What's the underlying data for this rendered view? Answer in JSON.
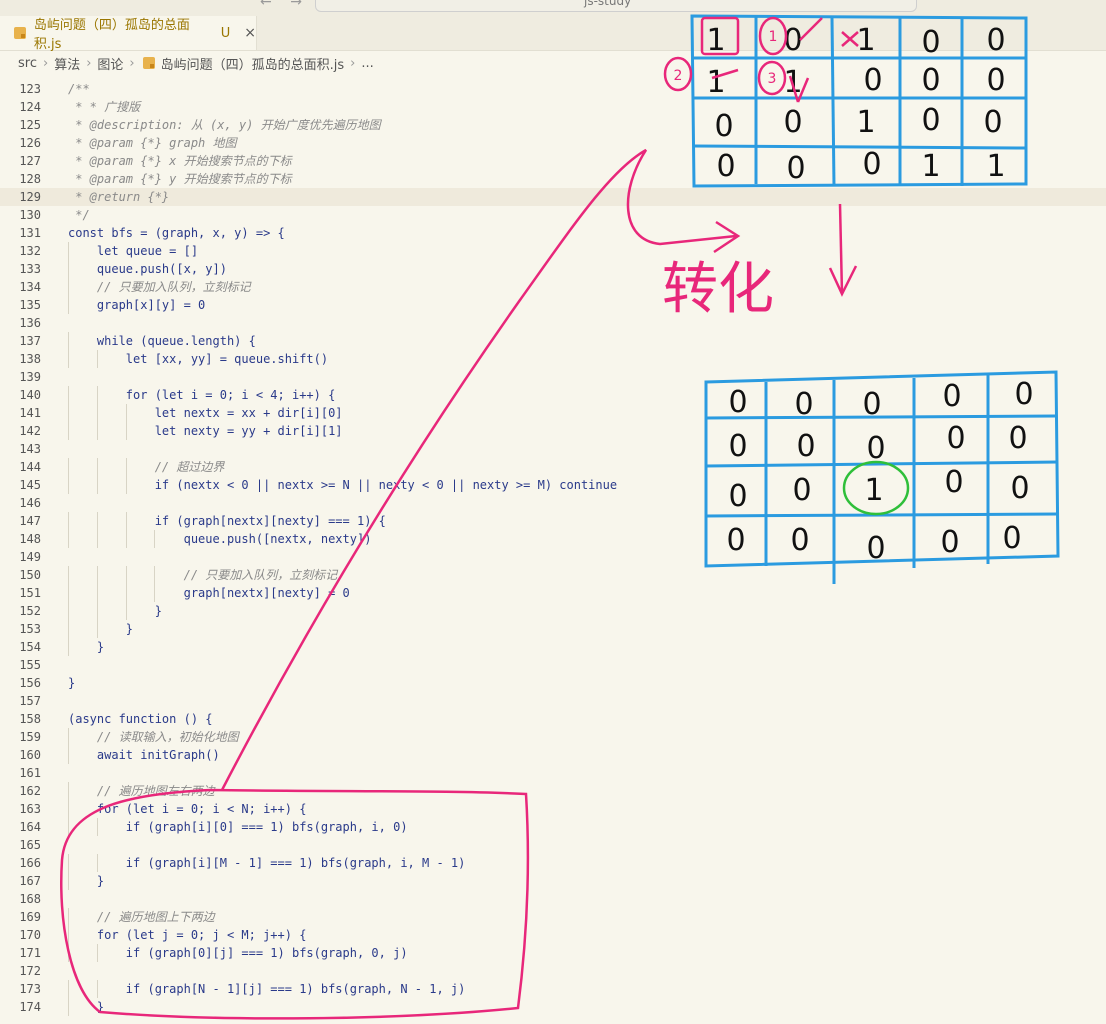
{
  "window": {
    "title": "js-study",
    "nav_back": "←",
    "nav_forward": "→"
  },
  "tab": {
    "title": "岛屿问题（四）孤岛的总面积.js",
    "status": "U",
    "close": "×"
  },
  "breadcrumb": [
    "src",
    "算法",
    "图论",
    "岛屿问题（四）孤岛的总面积.js",
    "..."
  ],
  "code_lines": [
    {
      "n": "123",
      "t": "/**"
    },
    {
      "n": "124",
      "t": " * * 广搜版"
    },
    {
      "n": "125",
      "t": " * @description: 从 (x, y) 开始广度优先遍历地图"
    },
    {
      "n": "126",
      "t": " * @param {*} graph 地图"
    },
    {
      "n": "127",
      "t": " * @param {*} x 开始搜索节点的下标"
    },
    {
      "n": "128",
      "t": " * @param {*} y 开始搜索节点的下标"
    },
    {
      "n": "129",
      "t": " * @return {*}"
    },
    {
      "n": "130",
      "t": " */"
    },
    {
      "n": "131",
      "t": "const bfs = (graph, x, y) => {"
    },
    {
      "n": "132",
      "t": "    let queue = []"
    },
    {
      "n": "133",
      "t": "    queue.push([x, y])"
    },
    {
      "n": "134",
      "t": "    // 只要加入队列，立刻标记"
    },
    {
      "n": "135",
      "t": "    graph[x][y] = 0"
    },
    {
      "n": "136",
      "t": ""
    },
    {
      "n": "137",
      "t": "    while (queue.length) {"
    },
    {
      "n": "138",
      "t": "        let [xx, yy] = queue.shift()"
    },
    {
      "n": "139",
      "t": ""
    },
    {
      "n": "140",
      "t": "        for (let i = 0; i < 4; i++) {"
    },
    {
      "n": "141",
      "t": "            let nextx = xx + dir[i][0]"
    },
    {
      "n": "142",
      "t": "            let nexty = yy + dir[i][1]"
    },
    {
      "n": "143",
      "t": ""
    },
    {
      "n": "144",
      "t": "            // 超过边界"
    },
    {
      "n": "145",
      "t": "            if (nextx < 0 || nextx >= N || nexty < 0 || nexty >= M) continue"
    },
    {
      "n": "146",
      "t": ""
    },
    {
      "n": "147",
      "t": "            if (graph[nextx][nexty] === 1) {"
    },
    {
      "n": "148",
      "t": "                queue.push([nextx, nexty])"
    },
    {
      "n": "149",
      "t": ""
    },
    {
      "n": "150",
      "t": "                // 只要加入队列，立刻标记"
    },
    {
      "n": "151",
      "t": "                graph[nextx][nexty] = 0"
    },
    {
      "n": "152",
      "t": "            }"
    },
    {
      "n": "153",
      "t": "        }"
    },
    {
      "n": "154",
      "t": "    }"
    },
    {
      "n": "155",
      "t": ""
    },
    {
      "n": "156",
      "t": "}"
    },
    {
      "n": "157",
      "t": ""
    },
    {
      "n": "158",
      "t": "(async function () {"
    },
    {
      "n": "159",
      "t": "    // 读取输入，初始化地图"
    },
    {
      "n": "160",
      "t": "    await initGraph()"
    },
    {
      "n": "161",
      "t": ""
    },
    {
      "n": "162",
      "t": "    // 遍历地图左右两边"
    },
    {
      "n": "163",
      "t": "    for (let i = 0; i < N; i++) {"
    },
    {
      "n": "164",
      "t": "        if (graph[i][0] === 1) bfs(graph, i, 0)"
    },
    {
      "n": "165",
      "t": ""
    },
    {
      "n": "166",
      "t": "        if (graph[i][M - 1] === 1) bfs(graph, i, M - 1)"
    },
    {
      "n": "167",
      "t": "    }"
    },
    {
      "n": "168",
      "t": ""
    },
    {
      "n": "169",
      "t": "    // 遍历地图上下两边"
    },
    {
      "n": "170",
      "t": "    for (let j = 0; j < M; j++) {"
    },
    {
      "n": "171",
      "t": "        if (graph[0][j] === 1) bfs(graph, 0, j)"
    },
    {
      "n": "172",
      "t": ""
    },
    {
      "n": "173",
      "t": "        if (graph[N - 1][j] === 1) bfs(graph, N - 1, j)"
    },
    {
      "n": "174",
      "t": "    }"
    }
  ],
  "annotations": {
    "label_transform": "转化",
    "grid_before": [
      [
        "1",
        "0",
        "1",
        "0",
        "0"
      ],
      [
        "1",
        "1",
        "0",
        "0",
        "0"
      ],
      [
        "0",
        "0",
        "1",
        "0",
        "0"
      ],
      [
        "0",
        "0",
        "0",
        "1",
        "1"
      ]
    ],
    "step_marks": [
      "1",
      "2",
      "3"
    ],
    "grid_after": [
      [
        "0",
        "0",
        "0",
        "0",
        "0"
      ],
      [
        "0",
        "0",
        "0",
        "0",
        "0"
      ],
      [
        "0",
        "0",
        "1",
        "0",
        "0"
      ],
      [
        "0",
        "0",
        "0",
        "0",
        "0"
      ]
    ],
    "colors": {
      "pink": "#e8277a",
      "blue": "#2b9be0",
      "green": "#2fbf3a"
    }
  }
}
